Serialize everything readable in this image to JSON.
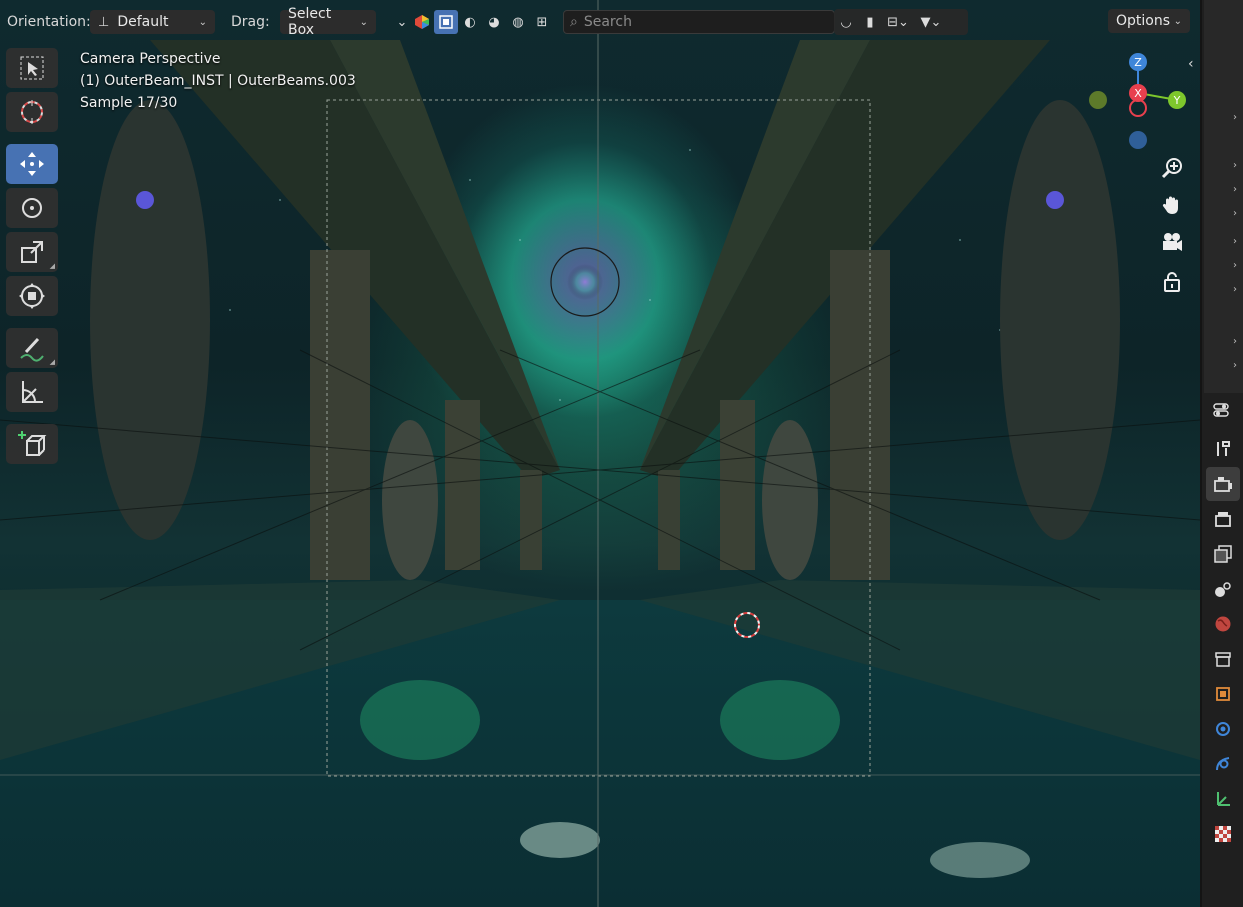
{
  "header": {
    "orientation_label": "Orientation:",
    "orientation_value": "Default",
    "drag_label": "Drag:",
    "drag_value": "Select Box",
    "search_placeholder": "Search",
    "options_label": "Options"
  },
  "overlay": {
    "line1": "Camera Perspective",
    "line2": "(1) OuterBeam_INST | OuterBeams.003",
    "line3": "Sample 17/30"
  },
  "gizmo": {
    "z_label": "Z",
    "x_label": "X",
    "y_label": "Y",
    "colors": {
      "x": "#e8404e",
      "y": "#7ec72c",
      "z": "#3f86d9"
    }
  },
  "toolbar": {
    "tools": [
      "select-box",
      "cursor",
      "move",
      "rotate",
      "scale",
      "transform",
      "annotate",
      "measure",
      "add-cube"
    ],
    "active_tool": "move"
  },
  "properties_tabs": [
    "tool",
    "render",
    "output",
    "view-layer",
    "scene",
    "world",
    "collection",
    "object",
    "modifiers",
    "particles",
    "physics",
    "constraints",
    "data",
    "texture"
  ],
  "colors": {
    "accent": "#4772b3"
  }
}
